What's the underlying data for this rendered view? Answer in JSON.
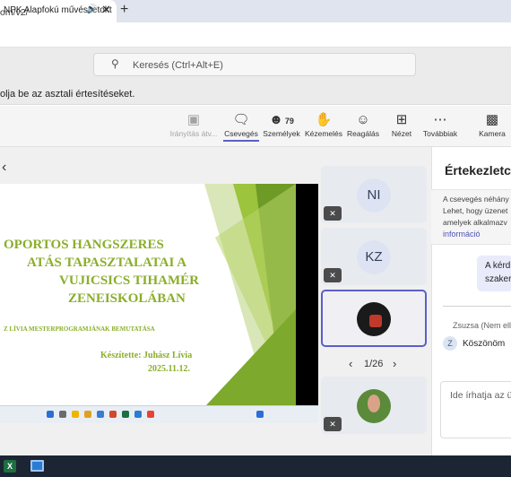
{
  "browser": {
    "tab_title": "NPK Alapfokú művészetokt",
    "new_tab": "+",
    "url_text": "om/v2/"
  },
  "teams": {
    "search_placeholder": "Keresés (Ctrl+Alt+E)",
    "notification": "olja be az asztali értesítéseket."
  },
  "toolbar": {
    "control": "Irányítás átv...",
    "chat": "Csevegés",
    "people": "Személyek",
    "people_count": "79",
    "raise_hand": "Kézemelés",
    "react": "Reagálás",
    "view": "Nézet",
    "more": "Továbbiak",
    "camera": "Kamera"
  },
  "slide": {
    "title_lines": [
      "OPORTOS HANGSZERES",
      "ATÁS TAPASZTALATAI A",
      "VUJICSICS TIHAMÉR",
      "ZENEISKOLÁBAN"
    ],
    "subtitle": "Z LÍVIA MESTERPROGRAMJÁNAK BEMUTATÁSA",
    "author": "Készítette: Juhász Lívia",
    "date": "2025.11.12."
  },
  "participants": [
    {
      "initials": "NI"
    },
    {
      "initials": "KZ"
    },
    {
      "initials": ""
    },
    {
      "initials": ""
    }
  ],
  "pager": {
    "label": "1/26"
  },
  "chat": {
    "title": "Értekezletcs",
    "info_lines": [
      "A csevegés néhány",
      "Lehet, hogy üzenet",
      "amelyek alkalmazv"
    ],
    "info_link": "információ",
    "message_lines": [
      "A kérd",
      "szaker"
    ],
    "sender": "Zsuzsa (Nem elle",
    "sender_initial": "Z",
    "sender_message": "Köszönöm",
    "input_placeholder": "Ide írhatja az ü"
  },
  "colors": {
    "teams_accent": "#5b5fc7",
    "slide_green": "#8aae2a"
  }
}
